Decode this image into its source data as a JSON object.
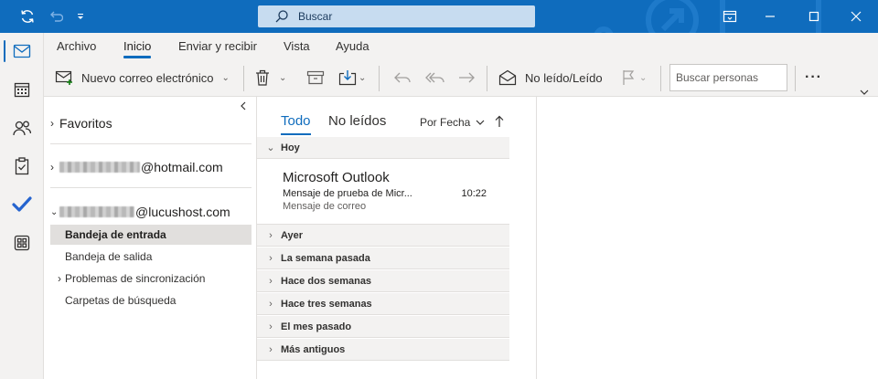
{
  "titlebar": {
    "search_placeholder": "Buscar",
    "accent_color": "#0f6cbd",
    "icons": [
      "sync-icon",
      "undo-icon",
      "customize-qat-icon",
      "search-icon",
      "ribbon-display-icon",
      "minimize-icon",
      "maximize-icon",
      "close-icon"
    ]
  },
  "rail": {
    "items": [
      "mail-icon",
      "calendar-icon",
      "people-icon",
      "tasks-icon",
      "todo-icon",
      "apps-icon"
    ]
  },
  "ribbon": {
    "tabs": [
      "Archivo",
      "Inicio",
      "Enviar y recibir",
      "Vista",
      "Ayuda"
    ],
    "active_tab": "Inicio",
    "new_email_label": "Nuevo correo electrónico",
    "read_unread_label": "No leído/Leído",
    "people_search_placeholder": "Buscar personas",
    "more_label": "···"
  },
  "folders": {
    "favorites_label": "Favoritos",
    "account1_suffix": "@hotmail.com",
    "account2_suffix": "@lucushost.com",
    "items": [
      {
        "label": "Bandeja de entrada",
        "selected": true,
        "expandable": false
      },
      {
        "label": "Bandeja de salida",
        "selected": false,
        "expandable": false
      },
      {
        "label": "Problemas de sincronización",
        "selected": false,
        "expandable": true
      },
      {
        "label": "Carpetas de búsqueda",
        "selected": false,
        "expandable": false
      }
    ]
  },
  "message_list": {
    "tabs": [
      "Todo",
      "No leídos"
    ],
    "active_tab": "Todo",
    "sort_label": "Por Fecha",
    "groups": [
      "Hoy",
      "Ayer",
      "La semana pasada",
      "Hace dos semanas",
      "Hace tres semanas",
      "El mes pasado",
      "Más antiguos"
    ],
    "message": {
      "sender": "Microsoft Outlook",
      "subject": "Mensaje de prueba de Micr...",
      "time": "10:22",
      "preview": "Mensaje de correo"
    }
  }
}
